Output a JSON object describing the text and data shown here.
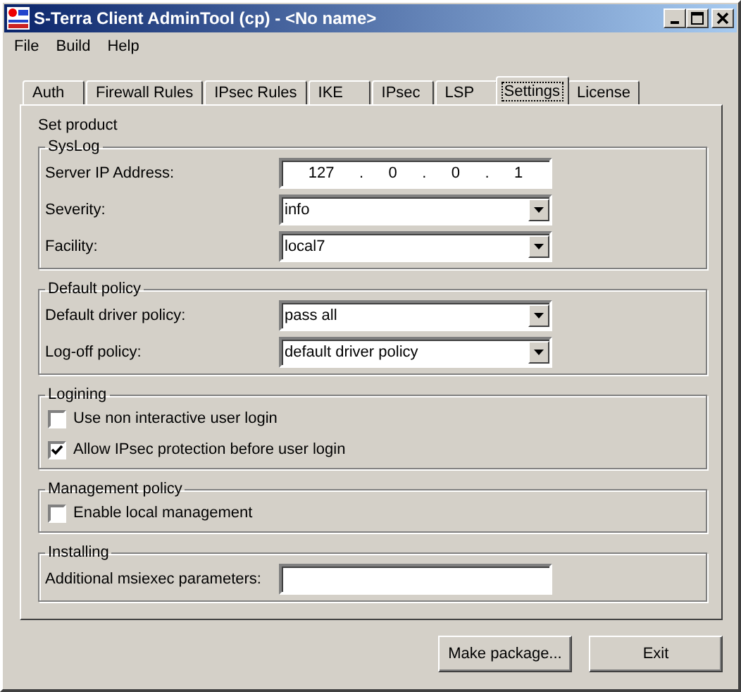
{
  "window": {
    "title": "S-Terra Client AdminTool (cp) - <No name>"
  },
  "menu": [
    "File",
    "Build",
    "Help"
  ],
  "tabs": [
    {
      "label": "Auth",
      "selected": false
    },
    {
      "label": "Firewall Rules",
      "selected": false
    },
    {
      "label": "IPsec Rules",
      "selected": false
    },
    {
      "label": "IKE",
      "selected": false
    },
    {
      "label": "IPsec",
      "selected": false
    },
    {
      "label": "LSP",
      "selected": false
    },
    {
      "label": "Settings",
      "selected": true
    },
    {
      "label": "License",
      "selected": false
    }
  ],
  "section_title": "Set product",
  "groups": [
    {
      "title": "SysLog",
      "rows": [
        {
          "kind": "ip",
          "label": "Server IP Address:",
          "octets": [
            "127",
            "0",
            "0",
            "1"
          ],
          "separator": "."
        },
        {
          "kind": "select",
          "label": "Severity:",
          "value": "info"
        },
        {
          "kind": "select",
          "label": "Facility:",
          "value": "local7"
        }
      ]
    },
    {
      "title": "Default policy",
      "rows": [
        {
          "kind": "select",
          "label": "Default driver policy:",
          "value": "pass all"
        },
        {
          "kind": "select",
          "label": "Log-off policy:",
          "value": "default driver policy"
        }
      ]
    },
    {
      "title": "Logining",
      "rows": [
        {
          "kind": "checkbox",
          "label": "Use non interactive user login",
          "checked": false
        },
        {
          "kind": "checkbox",
          "label": "Allow IPsec protection before user login",
          "checked": true
        }
      ]
    },
    {
      "title": "Management policy",
      "rows": [
        {
          "kind": "checkbox",
          "label": "Enable local management",
          "checked": false
        }
      ]
    },
    {
      "title": "Installing",
      "rows": [
        {
          "kind": "text",
          "label": "Additional msiexec parameters:"
        }
      ]
    }
  ],
  "buttons": [
    "Make package...",
    "Exit"
  ]
}
